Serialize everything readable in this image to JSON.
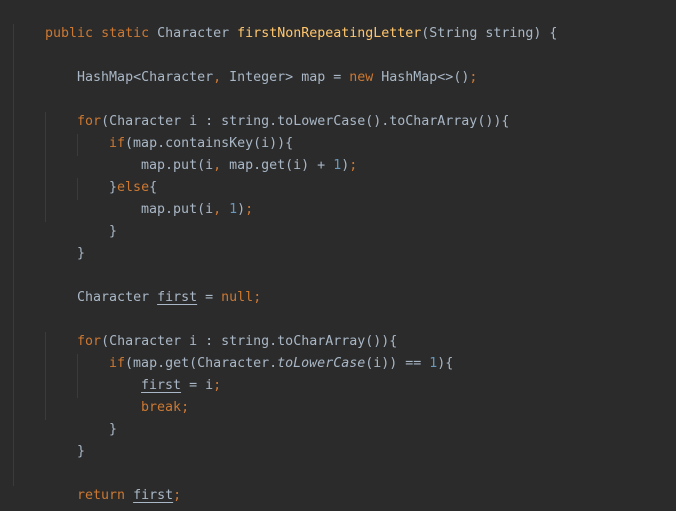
{
  "code": {
    "l1": {
      "a": "public static ",
      "b": "Character ",
      "c": "firstNonRepeatingLetter",
      "d": "(String string) {"
    },
    "l3": {
      "a": "HashMap<Character",
      "b": ", ",
      "c": "Integer> map = ",
      "d": "new ",
      "e": "HashMap<>()",
      "f": ";"
    },
    "l5": {
      "a": "for",
      "b": "(Character i : string.toLowerCase().toCharArray()){"
    },
    "l6": {
      "a": "if",
      "b": "(map.containsKey(i)){"
    },
    "l7": {
      "a": "map.put(i",
      "b": ", ",
      "c": "map.get(i) + ",
      "d": "1",
      "e": ")",
      "f": ";"
    },
    "l8": {
      "a": "}",
      "b": "else",
      "c": "{"
    },
    "l9": {
      "a": "map.put(i",
      "b": ", ",
      "c": "1",
      "d": ")",
      "e": ";"
    },
    "l10": "}",
    "l11": "}",
    "l13": {
      "a": "Character ",
      "b": "first",
      "c": " = ",
      "d": "null",
      "e": ";"
    },
    "l15": {
      "a": "for",
      "b": "(Character i : string.toCharArray()){"
    },
    "l16": {
      "a": "if",
      "b": "(map.get(Character.",
      "c": "toLowerCase",
      "d": "(i)) == ",
      "e": "1",
      "f": "){"
    },
    "l17": {
      "a": "first",
      "b": " = i",
      "c": ";"
    },
    "l18": {
      "a": "break",
      "b": ";"
    },
    "l19": "}",
    "l20": "}",
    "l22": {
      "a": "return ",
      "b": "first",
      "c": ";"
    },
    "l23": "}"
  },
  "colors": {
    "background": "#2b2b2b",
    "keyword": "#cc7832",
    "method_declaration": "#ffc66d",
    "number": "#6897bb",
    "plain": "#a9b7c6"
  }
}
